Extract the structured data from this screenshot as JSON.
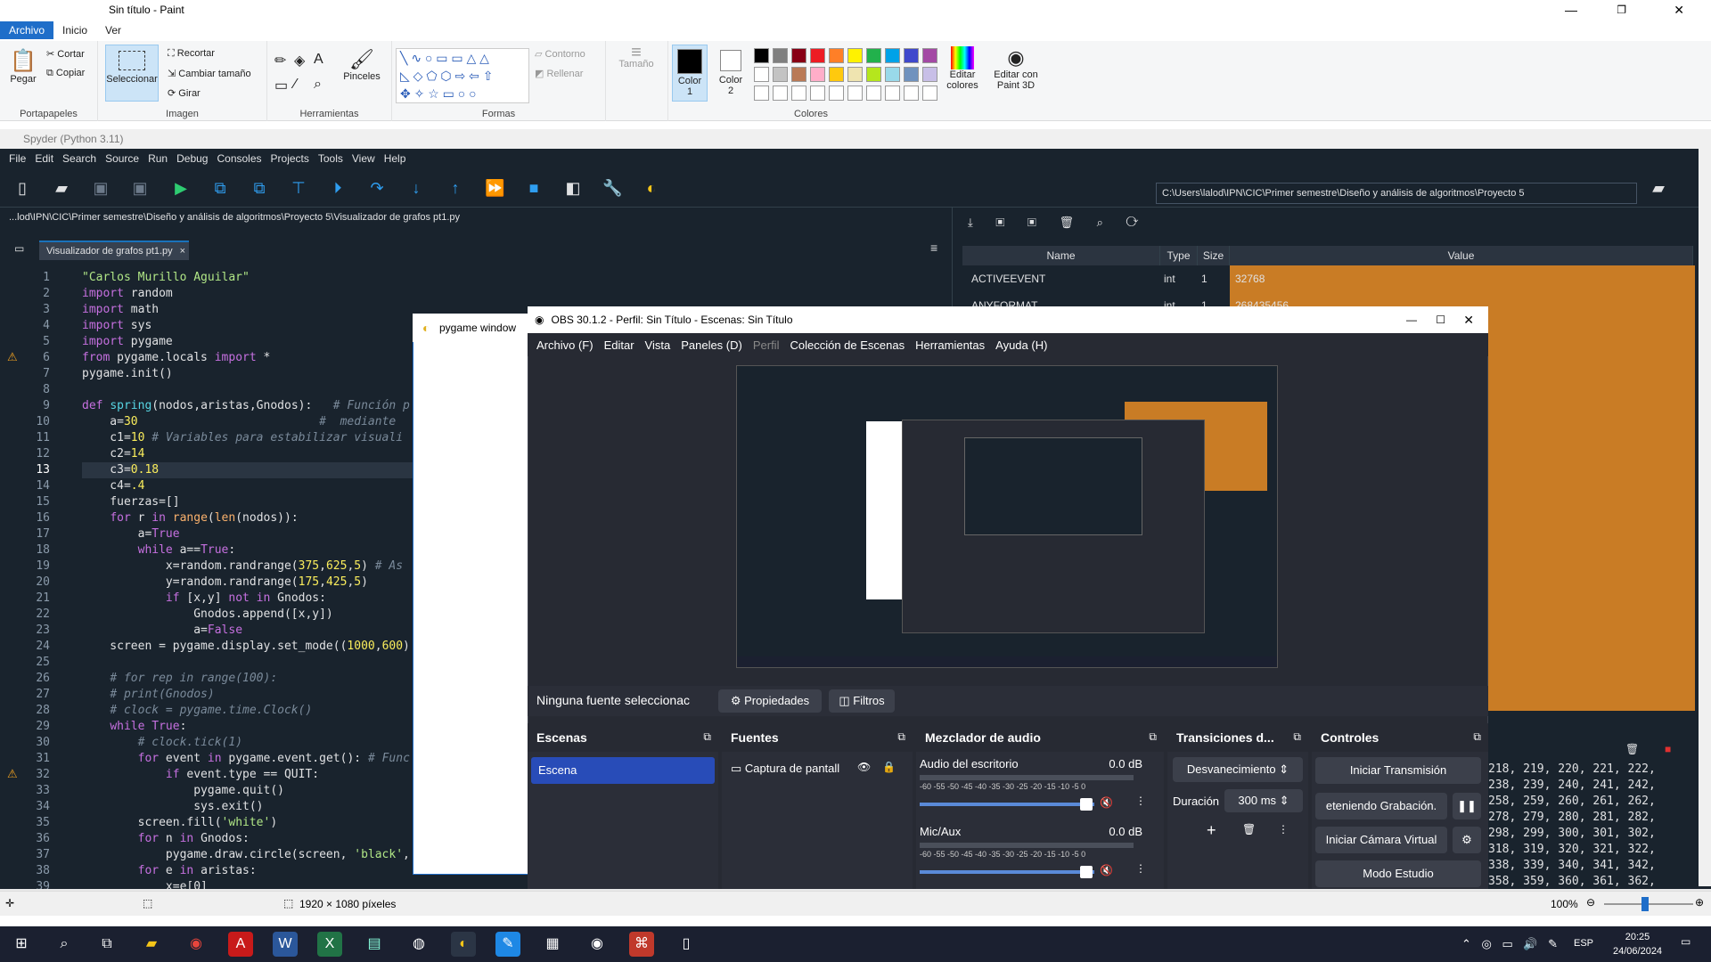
{
  "paint": {
    "title": "Sin título - Paint",
    "tabs": [
      "Archivo",
      "Inicio",
      "Ver"
    ],
    "clipboard": {
      "paste": "Pegar",
      "cut": "Cortar",
      "copy": "Copiar",
      "group": "Portapapeles"
    },
    "image": {
      "select": "Seleccionar",
      "crop": "Recortar",
      "resize": "Cambiar tamaño",
      "rotate": "Girar",
      "group": "Imagen"
    },
    "tools_group": "Herramientas",
    "brushes": "Pinceles",
    "shapes": {
      "outline": "Contorno",
      "fill": "Rellenar",
      "group": "Formas"
    },
    "size": "Tamaño",
    "color1": "Color\n1",
    "color2": "Color\n2",
    "colors_group": "Colores",
    "edit_colors": "Editar colores",
    "edit_3d": "Editar con Paint 3D",
    "status_size": "1920 × 1080 píxeles",
    "zoom": "100%",
    "palette": [
      "#000000",
      "#7f7f7f",
      "#880015",
      "#ed1c24",
      "#ff7f27",
      "#fff200",
      "#22b14c",
      "#00a2e8",
      "#3f48cc",
      "#a349a4",
      "#ffffff",
      "#c3c3c3",
      "#b97a57",
      "#ffaec9",
      "#ffc90e",
      "#efe4b0",
      "#b5e61d",
      "#99d9ea",
      "#7092be",
      "#c8bfe7"
    ]
  },
  "spyder": {
    "title": "Spyder (Python 3.11)",
    "menu": [
      "File",
      "Edit",
      "Search",
      "Source",
      "Run",
      "Debug",
      "Consoles",
      "Projects",
      "Tools",
      "View",
      "Help"
    ],
    "path": "C:\\Users\\lalod\\IPN\\CIC\\Primer semestre\\Diseño y análisis de algoritmos\\Proyecto 5",
    "file_path": "...lod\\IPN\\CIC\\Primer semestre\\Diseño y análisis de algoritmos\\Proyecto 5\\Visualizador de grafos pt1.py",
    "tab": "Visualizador de grafos pt1.py",
    "var_headers": {
      "name": "Name",
      "type": "Type",
      "size": "Size",
      "value": "Value"
    },
    "vars": [
      {
        "name": "ACTIVEEVENT",
        "type": "int",
        "size": "1",
        "value": "32768"
      },
      {
        "name": "ANYFORMAT",
        "type": "int",
        "size": "1",
        "value": "268435456"
      }
    ],
    "console": [
      "218, 219, 220, 221, 222,",
      "238, 239, 240, 241, 242,",
      "258, 259, 260, 261, 262,",
      "278, 279, 280, 281, 282,",
      "298, 299, 300, 301, 302,",
      "318, 319, 320, 321, 322,",
      "338, 339, 340, 341, 342,",
      "358, 359, 360, 361, 362,"
    ]
  },
  "code_lines": [
    [
      "1",
      "<span class='st'>\"Carlos Murillo Aguilar\"</span>"
    ],
    [
      "2",
      "<span class='kw'>import</span> random"
    ],
    [
      "3",
      "<span class='kw'>import</span> math"
    ],
    [
      "4",
      "<span class='kw'>import</span> sys"
    ],
    [
      "5",
      "<span class='kw'>import</span> pygame"
    ],
    [
      "6",
      "<span class='kw'>from</span> pygame.locals <span class='kw'>import</span> *"
    ],
    [
      "7",
      "pygame.init()"
    ],
    [
      "8",
      ""
    ],
    [
      "9",
      "<span class='kw'>def</span> <span class='fn'>spring</span>(nodos,aristas,Gnodos):   <span class='cm'># Función p</span>"
    ],
    [
      "10",
      "    a=<span class='nm'>30</span>                          <span class='cm'>#  mediante</span>"
    ],
    [
      "11",
      "    c1=<span class='nm'>10</span> <span class='cm'># Variables para estabilizar visuali</span>"
    ],
    [
      "12",
      "    c2=<span class='nm'>14</span>"
    ],
    [
      "13",
      "    c3=<span class='nm'>0.18</span>"
    ],
    [
      "14",
      "    c4=<span class='nm'>.4</span>"
    ],
    [
      "15",
      "    fuerzas=[]"
    ],
    [
      "16",
      "    <span class='kw'>for</span> r <span class='kw'>in</span> <span class='bi'>range</span>(<span class='bi'>len</span>(nodos)):"
    ],
    [
      "17",
      "        a=<span class='kw'>True</span>"
    ],
    [
      "18",
      "        <span class='kw'>while</span> a==<span class='kw'>True</span>:"
    ],
    [
      "19",
      "            x=random.randrange(<span class='nm'>375</span>,<span class='nm'>625</span>,<span class='nm'>5</span>) <span class='cm'># As</span>"
    ],
    [
      "20",
      "            y=random.randrange(<span class='nm'>175</span>,<span class='nm'>425</span>,<span class='nm'>5</span>)"
    ],
    [
      "21",
      "            <span class='kw'>if</span> [x,y] <span class='kw'>not in</span> Gnodos:"
    ],
    [
      "22",
      "                Gnodos.append([x,y])"
    ],
    [
      "23",
      "                a=<span class='kw'>False</span>"
    ],
    [
      "24",
      "    screen = pygame.display.set_mode((<span class='nm'>1000</span>,<span class='nm'>600</span>)"
    ],
    [
      "25",
      ""
    ],
    [
      "26",
      "    <span class='cm'># for rep in range(100):</span>"
    ],
    [
      "27",
      "    <span class='cm'># print(Gnodos)</span>"
    ],
    [
      "28",
      "    <span class='cm'># clock = pygame.time.Clock()</span>"
    ],
    [
      "29",
      "    <span class='kw'>while</span> <span class='kw'>True</span>:"
    ],
    [
      "30",
      "        <span class='cm'># clock.tick(1)</span>"
    ],
    [
      "31",
      "        <span class='kw'>for</span> event <span class='kw'>in</span> pygame.event.get(): <span class='cm'># Func</span>"
    ],
    [
      "32",
      "            <span class='kw'>if</span> event.type == QUIT:"
    ],
    [
      "33",
      "                pygame.quit()"
    ],
    [
      "34",
      "                sys.exit()"
    ],
    [
      "35",
      "        screen.fill(<span class='st'>'white'</span>)"
    ],
    [
      "36",
      "        <span class='kw'>for</span> n <span class='kw'>in</span> Gnodos:"
    ],
    [
      "37",
      "            pygame.draw.circle(screen, <span class='st'>'black'</span>,"
    ],
    [
      "38",
      "        <span class='kw'>for</span> e <span class='kw'>in</span> aristas:"
    ],
    [
      "39",
      "            x=e[0]"
    ]
  ],
  "pygame": {
    "title": "pygame window"
  },
  "obs": {
    "title": "OBS 30.1.2 - Perfil: Sin Título - Escenas: Sin Título",
    "menu": [
      "Archivo (F)",
      "Editar",
      "Vista",
      "Paneles (D)",
      "Perfil",
      "Colección de Escenas",
      "Herramientas",
      "Ayuda (H)"
    ],
    "no_source": "Ninguna fuente seleccionac",
    "properties": "Propiedades",
    "filters": "Filtros",
    "scenes_title": "Escenas",
    "scene": "Escena",
    "sources_title": "Fuentes",
    "source": "Captura de pantall",
    "mixer_title": "Mezclador de audio",
    "desktop_audio": "Audio del escritorio",
    "desktop_db": "0.0 dB",
    "mic": "Mic/Aux",
    "mic_db": "0.0 dB",
    "meter_ticks": "-60 -55 -50 -45 -40 -35 -30 -25 -20 -15 -10 -5 0",
    "transitions_title": "Transiciones d...",
    "transition": "Desvanecimiento",
    "duration_label": "Duración",
    "duration": "300 ms",
    "controls_title": "Controles",
    "start_stream": "Iniciar Transmisión",
    "stop_rec": "eteniendo Grabación.",
    "virtual_cam": "Iniciar Cámara Virtual",
    "studio": "Modo Estudio"
  },
  "taskbar": {
    "lang": "ESP",
    "time": "20:25",
    "date": "24/06/2024"
  }
}
